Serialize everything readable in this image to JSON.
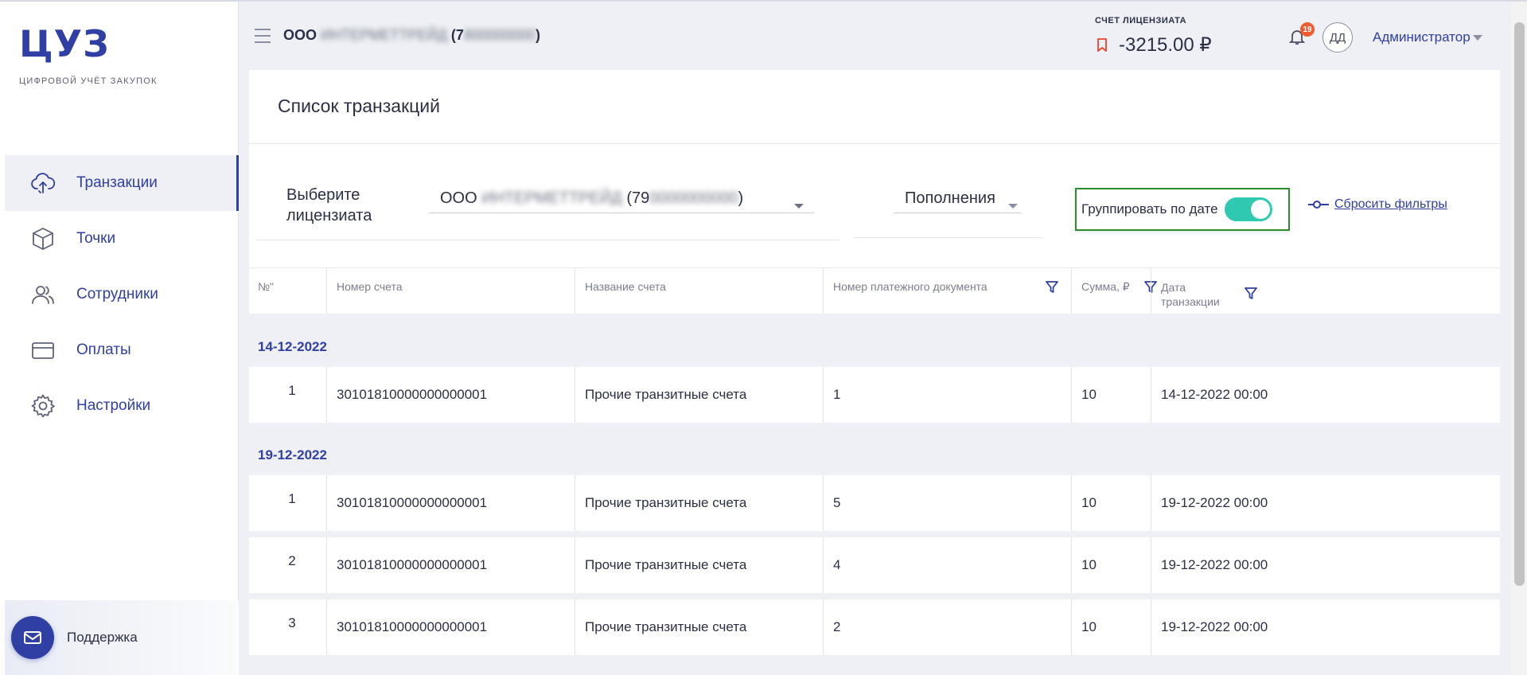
{
  "sidebar": {
    "logo": "ЦУЗ",
    "logo_subtitle": "ЦИФРОВОЙ УЧЁТ ЗАКУПОК",
    "items": [
      {
        "label": "Транзакции",
        "icon": "cloud-upload-icon",
        "active": true
      },
      {
        "label": "Точки",
        "icon": "cube-icon",
        "active": false
      },
      {
        "label": "Сотрудники",
        "icon": "users-icon",
        "active": false
      },
      {
        "label": "Оплаты",
        "icon": "card-icon",
        "active": false
      },
      {
        "label": "Настройки",
        "icon": "gear-icon",
        "active": false
      }
    ],
    "support_label": "Поддержка"
  },
  "header": {
    "org_prefix": "ООО",
    "org_name_blurred": "ИНТЕРМЕТТРЕЙД",
    "org_inn_prefix": "(7",
    "org_inn_blurred": "800000000",
    "org_inn_suffix": ")",
    "account_label": "СЧЕТ ЛИЦЕНЗИАТА",
    "account_value": "-3215.00 ₽",
    "notifications_count": "19",
    "avatar_initials": "ДД",
    "user_name": "Администратор"
  },
  "page": {
    "title": "Список транзакций"
  },
  "filters": {
    "licensee_label": "Выберите лицензиата",
    "licensee_prefix": "ООО",
    "licensee_name_blurred": "ИНТЕРМЕТТРЕЙД",
    "licensee_inn_prefix": "(79",
    "licensee_inn_blurred": "0000000000",
    "licensee_inn_suffix": ")",
    "type_value": "Пополнения",
    "group_by_date_label": "Группировать по дате",
    "group_by_date_on": true,
    "reset_label": "Сбросить фильтры"
  },
  "table": {
    "columns": [
      "№\"",
      "Номер счета",
      "Название счета",
      "Номер платежного документа",
      "Сумма, ₽",
      "Дата транзакции"
    ],
    "groups": [
      {
        "date": "14-12-2022",
        "rows": [
          {
            "n": "1",
            "account": "30101810000000000001",
            "name": "Прочие транзитные счета",
            "doc": "1",
            "sum": "10",
            "date": "14-12-2022 00:00"
          }
        ]
      },
      {
        "date": "19-12-2022",
        "rows": [
          {
            "n": "1",
            "account": "30101810000000000001",
            "name": "Прочие транзитные счета",
            "doc": "5",
            "sum": "10",
            "date": "19-12-2022 00:00"
          },
          {
            "n": "2",
            "account": "30101810000000000001",
            "name": "Прочие транзитные счета",
            "doc": "4",
            "sum": "10",
            "date": "19-12-2022 00:00"
          },
          {
            "n": "3",
            "account": "30101810000000000001",
            "name": "Прочие транзитные счета",
            "doc": "2",
            "sum": "10",
            "date": "19-12-2022 00:00"
          }
        ]
      }
    ]
  },
  "colors": {
    "accent": "#2f3fa4",
    "toggle_on": "#2fc9b2",
    "badge": "#ef5b31",
    "highlight_border": "#2e8b2e"
  }
}
